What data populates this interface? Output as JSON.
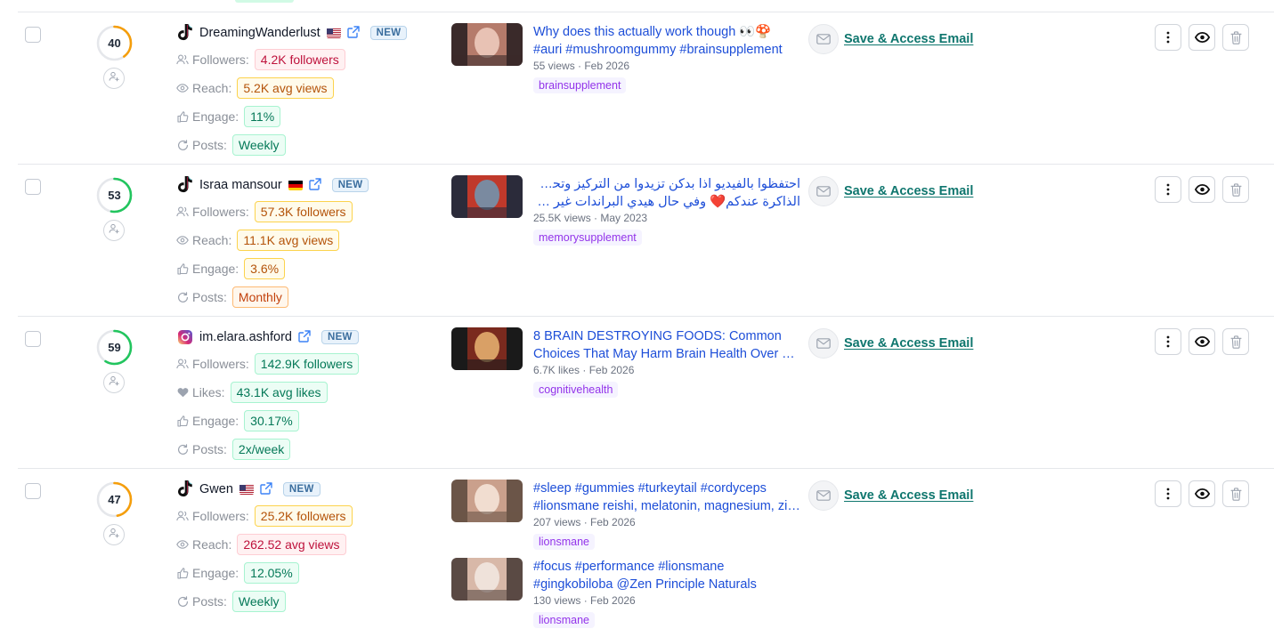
{
  "labels": {
    "followers": "Followers:",
    "reach": "Reach:",
    "likes": "Likes:",
    "engage": "Engage:",
    "posts": "Posts:",
    "new_badge": "NEW",
    "save_email": "Save & Access Email"
  },
  "colors": {
    "score_orange": "#f59e0b",
    "score_green": "#22c55e",
    "link_blue": "#1d4ed8",
    "email_teal": "#0f766e",
    "tag_purple": "#9333ea"
  },
  "creators": [
    {
      "score": "40",
      "score_fraction": 0.4,
      "platform": "tiktok",
      "handle": "DreamingWanderlust",
      "flag": "us-flag",
      "metrics": [
        {
          "kind": "followers",
          "value": "4.2K followers",
          "tone": "red"
        },
        {
          "kind": "reach",
          "value": "5.2K avg views",
          "tone": "orange"
        },
        {
          "kind": "engage",
          "value": "11%",
          "tone": "green"
        },
        {
          "kind": "posts",
          "value": "Weekly",
          "tone": "green"
        }
      ],
      "posts": [
        {
          "title": "Why does this actually work though 👀🍄",
          "title2": "#auri #mushroomgummy #brainsupplement",
          "meta": "55 views · Feb 2026",
          "tag": "brainsupplement"
        }
      ]
    },
    {
      "score": "53",
      "score_fraction": 0.53,
      "platform": "tiktok",
      "handle": "Israa mansour",
      "flag": "de-flag",
      "metrics": [
        {
          "kind": "followers",
          "value": "57.3K followers",
          "tone": "orange"
        },
        {
          "kind": "reach",
          "value": "11.1K avg views",
          "tone": "orange"
        },
        {
          "kind": "engage",
          "value": "3.6%",
          "tone": "orange"
        },
        {
          "kind": "posts",
          "value": "Monthly",
          "tone": "redorange"
        }
      ],
      "posts": [
        {
          "title": "احتفظوا بالفيديو اذا بدكن تزيدوا من التركيز وتحسنوا نشاط",
          "title2": "الذاكرة عندكم❤️ وفي حال هيدي البراندات غير متوفرة في",
          "meta": "25.5K views · May 2023",
          "tag": "memorysupplement"
        }
      ]
    },
    {
      "score": "59",
      "score_fraction": 0.59,
      "platform": "instagram",
      "handle": "im.elara.ashford",
      "flag": "",
      "metrics": [
        {
          "kind": "followers",
          "value": "142.9K followers",
          "tone": "green"
        },
        {
          "kind": "likes",
          "value": "43.1K avg likes",
          "tone": "green"
        },
        {
          "kind": "engage",
          "value": "30.17%",
          "tone": "green"
        },
        {
          "kind": "posts",
          "value": "2x/week",
          "tone": "green"
        }
      ],
      "posts": [
        {
          "title": "8 BRAIN DESTROYING FOODS: Common",
          "title2": "Choices That May Harm Brain Health Over Time",
          "meta": "6.7K likes · Feb 2026",
          "tag": "cognitivehealth"
        }
      ]
    },
    {
      "score": "47",
      "score_fraction": 0.47,
      "platform": "tiktok",
      "handle": "Gwen",
      "flag": "us-flag",
      "metrics": [
        {
          "kind": "followers",
          "value": "25.2K followers",
          "tone": "orange"
        },
        {
          "kind": "reach",
          "value": "262.52 avg views",
          "tone": "red"
        },
        {
          "kind": "engage",
          "value": "12.05%",
          "tone": "green"
        },
        {
          "kind": "posts",
          "value": "Weekly",
          "tone": "green"
        }
      ],
      "posts": [
        {
          "title": "#sleep #gummies #turkeytail #cordyceps",
          "title2": "#lionsmane reishi, melatonin, magnesium, zinc",
          "meta": "207 views · Feb 2026",
          "tag": "lionsmane"
        },
        {
          "title": "#focus #performance #lionsmane",
          "title2": "#gingkobiloba @Zen Principle Naturals",
          "meta": "130 views · Feb 2026",
          "tag": "lionsmane"
        }
      ]
    }
  ]
}
